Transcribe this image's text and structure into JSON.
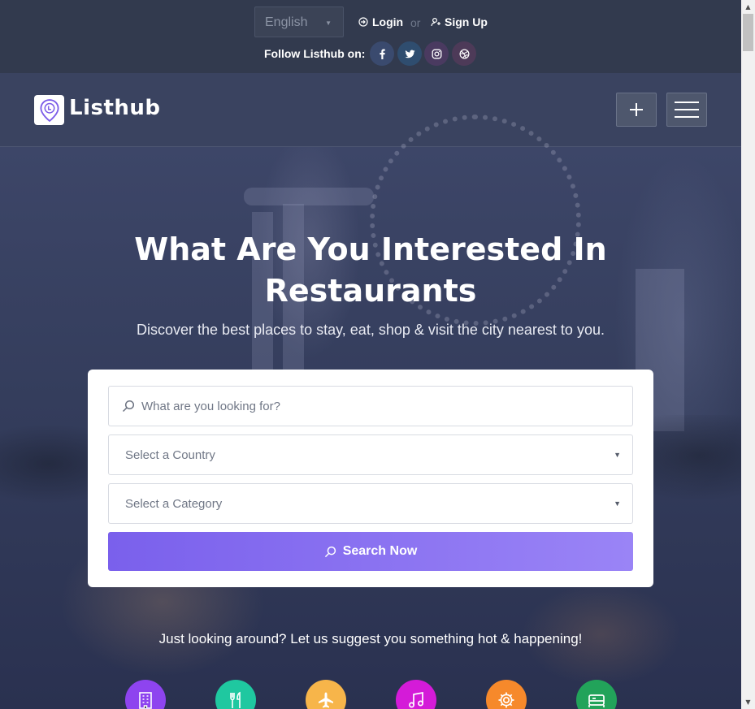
{
  "topbar": {
    "language": "English",
    "login_label": "Login",
    "or_label": "or",
    "signup_label": "Sign Up",
    "follow_label": "Follow Listhub on:",
    "social": [
      {
        "icon": "facebook-icon",
        "color": "#3b5998"
      },
      {
        "icon": "twitter-icon",
        "color": "#1da1f2"
      },
      {
        "icon": "instagram-icon",
        "color": "#8a3ab9"
      },
      {
        "icon": "dribbble-icon",
        "color": "#ea4c89"
      }
    ]
  },
  "header": {
    "logo_text": "Listhub",
    "add_icon": "plus-icon",
    "menu_icon": "hamburger-menu-icon"
  },
  "hero": {
    "title_line1": "What Are You Interested In",
    "title_line2": "Restaurants",
    "subtitle": "Discover the best places to stay, eat, shop & visit the city nearest to you."
  },
  "search": {
    "keyword_placeholder": "What are you looking for?",
    "country_placeholder": "Select a Country",
    "category_placeholder": "Select a Category",
    "button_label": "Search Now",
    "button_colors": [
      "#7a60ec",
      "#9a84f6"
    ]
  },
  "suggest": {
    "text": "Just looking around? Let us suggest you something hot & happening!",
    "categories": [
      {
        "icon": "building-icon",
        "color": "#8e44ef"
      },
      {
        "icon": "restaurant-icon",
        "color": "#1fc8a0"
      },
      {
        "icon": "airplane-icon",
        "color": "#f7b54a"
      },
      {
        "icon": "music-icon",
        "color": "#d41bd8"
      },
      {
        "icon": "gear-icon",
        "color": "#f6892b"
      },
      {
        "icon": "bed-icon",
        "color": "#22a35a"
      }
    ]
  }
}
